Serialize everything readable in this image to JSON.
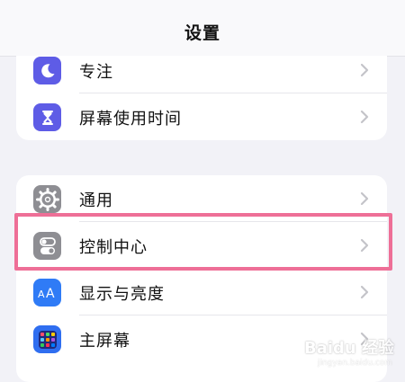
{
  "header": {
    "title": "设置"
  },
  "groups": [
    {
      "items": [
        {
          "label": "专注",
          "icon": "moon-icon",
          "icon_color": "#5e5ce6"
        },
        {
          "label": "屏幕使用时间",
          "icon": "hourglass-icon",
          "icon_color": "#5e5ce6"
        }
      ]
    },
    {
      "items": [
        {
          "label": "通用",
          "icon": "gear-icon",
          "icon_color": "#8e8e93"
        },
        {
          "label": "控制中心",
          "icon": "toggles-icon",
          "icon_color": "#8e8e93"
        },
        {
          "label": "显示与亮度",
          "icon": "text-size-icon",
          "icon_color": "#2f7bf6"
        },
        {
          "label": "主屏幕",
          "icon": "home-screen-icon",
          "icon_color": "#2f6ef0"
        }
      ]
    }
  ],
  "highlight": {
    "target": "控制中心",
    "color": "#ee6f97"
  },
  "watermark": {
    "brand": "Baidu 经验",
    "url": "jingyan.baidu.com"
  }
}
